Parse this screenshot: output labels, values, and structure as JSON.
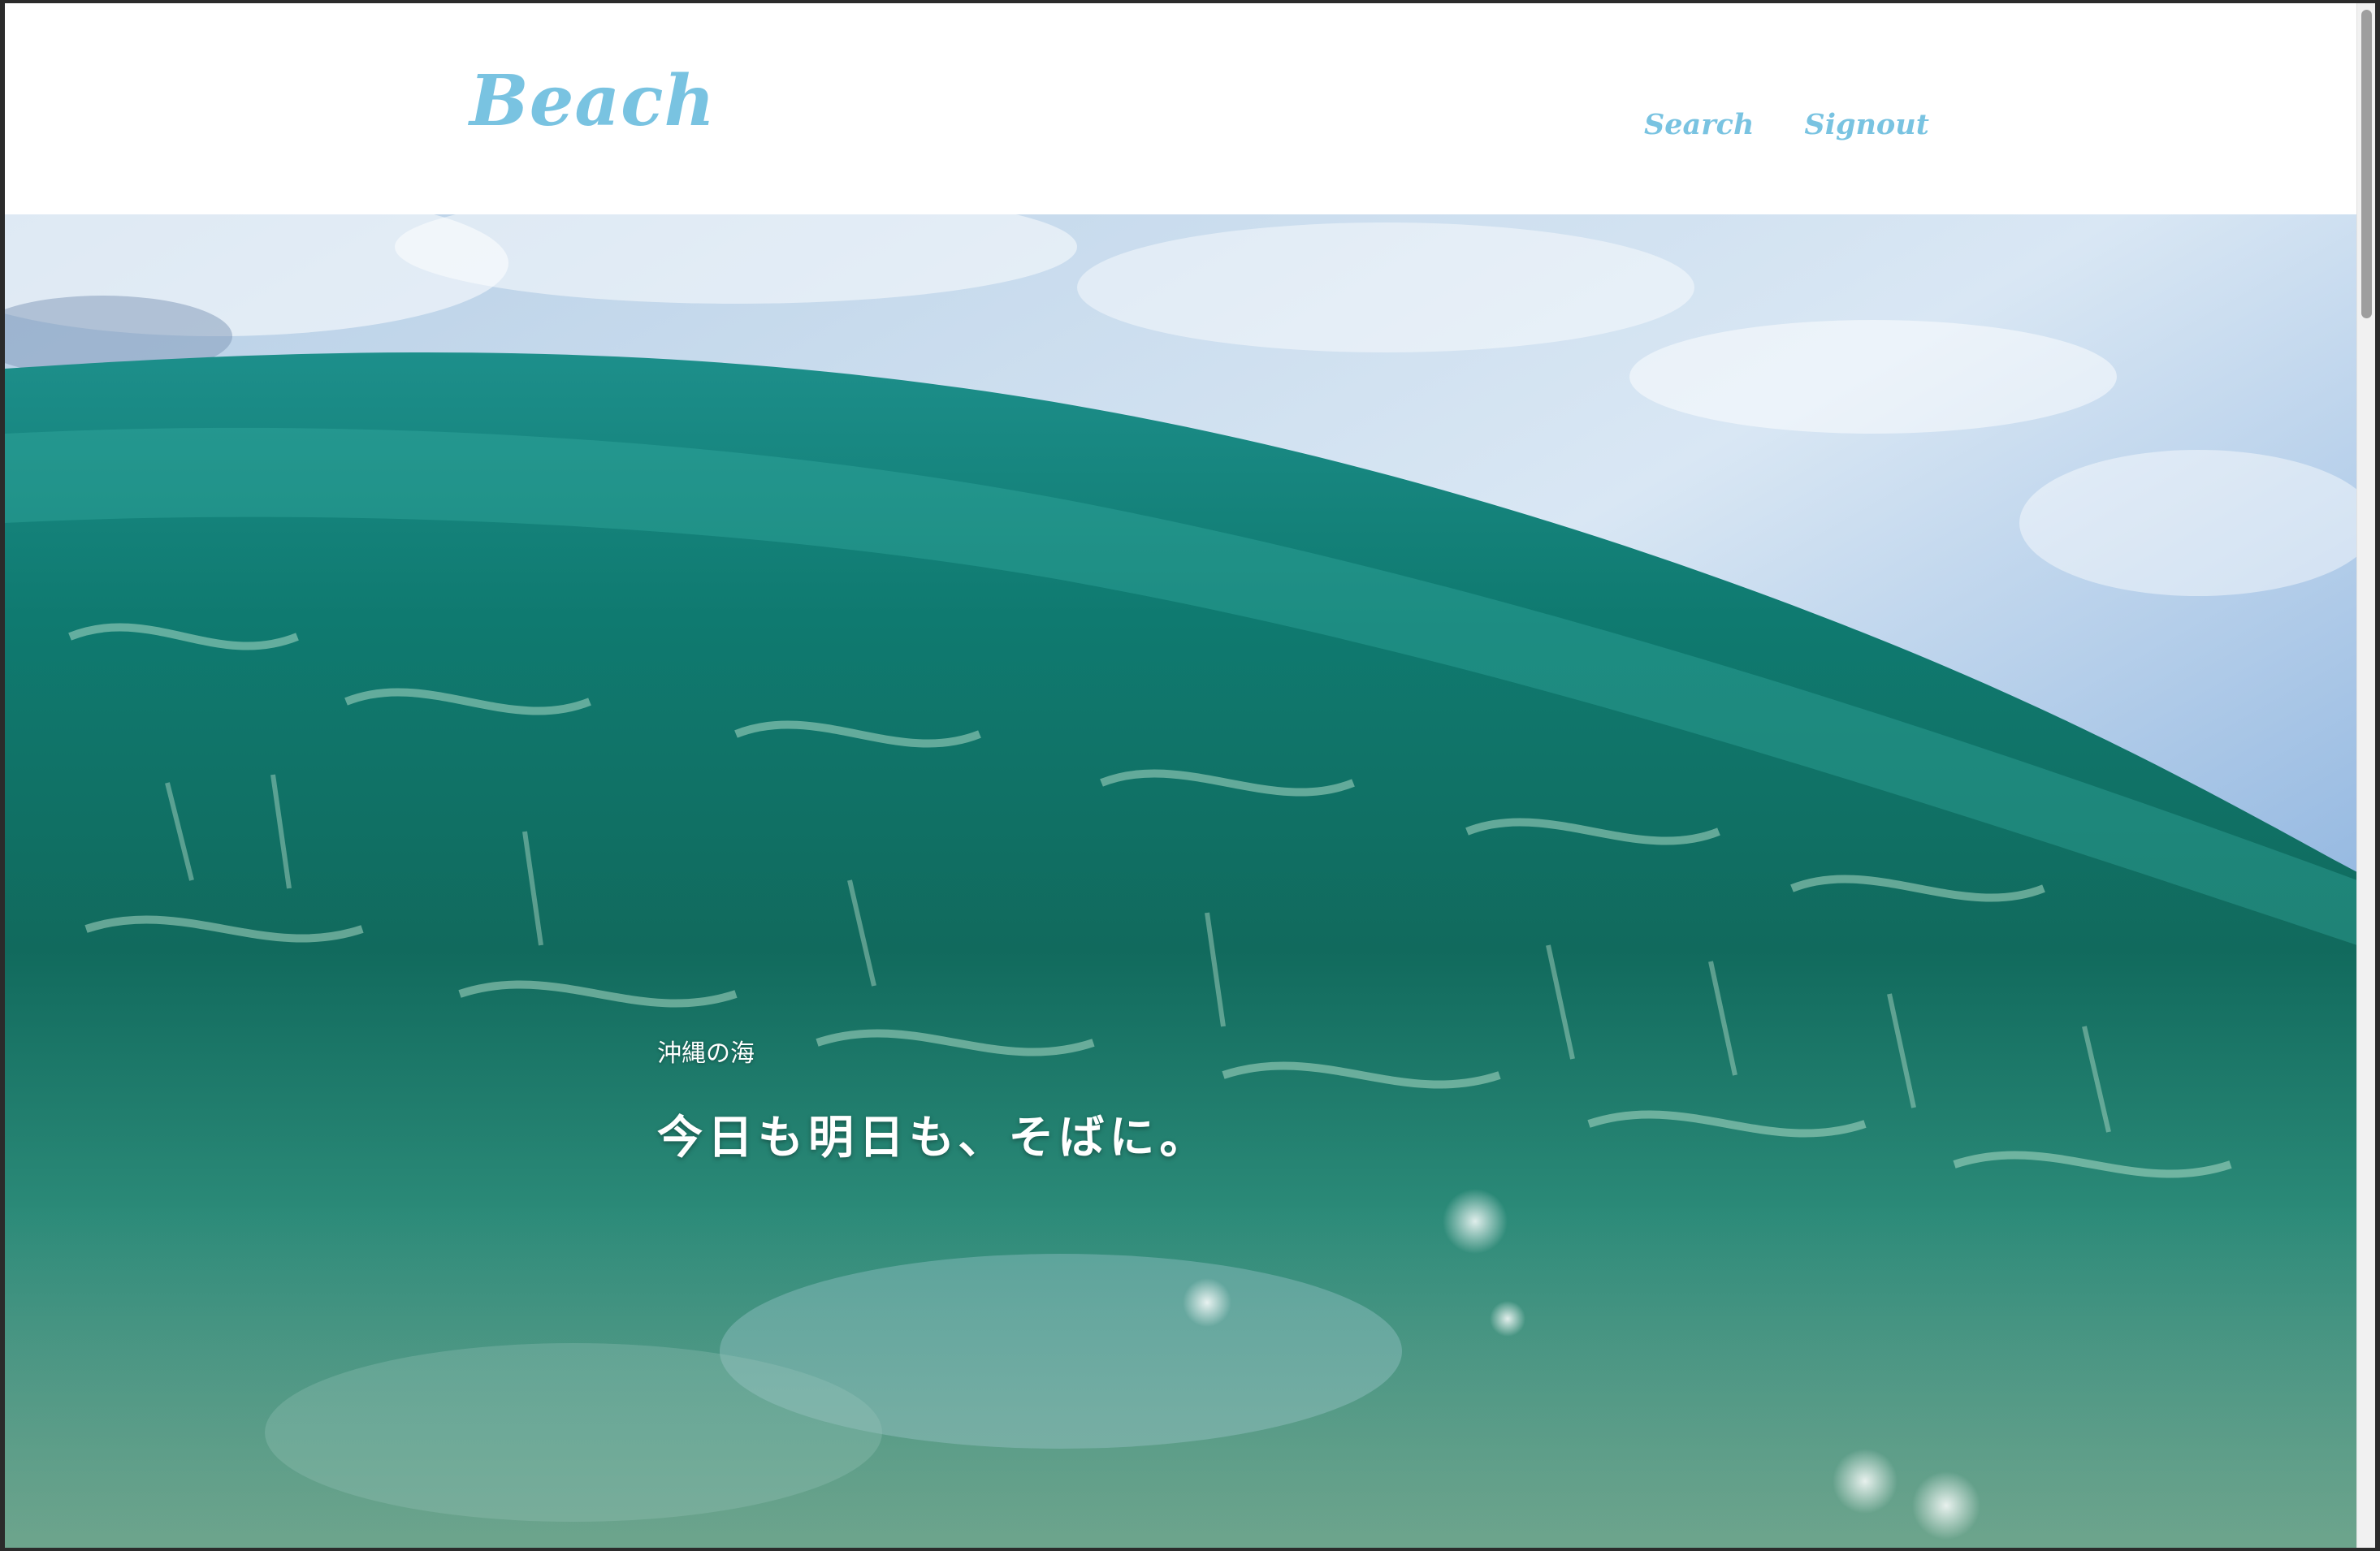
{
  "header": {
    "logo": "Beach",
    "nav": {
      "search": "Search",
      "signout": "Signout"
    }
  },
  "hero": {
    "subtitle": "沖縄の海",
    "title": "今日も明日も、そばに。"
  },
  "colors": {
    "accent": "#79c3e1",
    "background": "#ffffff",
    "hero_text": "#ffffff"
  }
}
